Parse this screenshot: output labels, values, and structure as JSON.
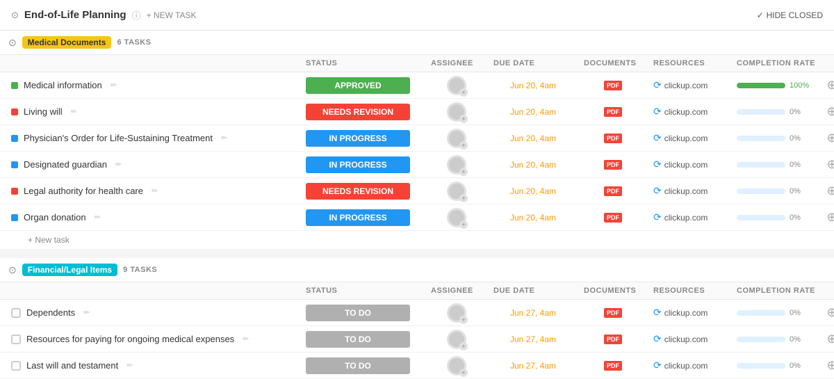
{
  "app": {
    "title": "End-of-Life Planning",
    "new_task_label": "+ NEW TASK",
    "hide_closed_label": "HIDE CLOSED"
  },
  "groups": [
    {
      "id": "medical",
      "collapse_icon": "⊙",
      "badge_label": "Medical Documents",
      "badge_class": "badge-yellow",
      "task_count": "6 TASKS",
      "columns": [
        "STATUS",
        "ASSIGNEE",
        "DUE DATE",
        "DOCUMENTS",
        "RESOURCES",
        "COMPLETION RATE"
      ],
      "tasks": [
        {
          "name": "Medical information",
          "dot_class": "dot-green",
          "status": "APPROVED",
          "status_class": "status-approved",
          "due_date": "Jun 20, 4am",
          "due_class": "due-date-normal",
          "resource": "clickup.com",
          "completion": 100,
          "completion_label": "100%",
          "pct_class": "full"
        },
        {
          "name": "Living will",
          "dot_class": "dot-red",
          "status": "NEEDS REVISION",
          "status_class": "status-needs-revision",
          "due_date": "Jun 20, 4am",
          "due_class": "",
          "resource": "clickup.com",
          "completion": 0,
          "completion_label": "0%",
          "pct_class": ""
        },
        {
          "name": "Physician's Order for Life-Sustaining Treatment",
          "dot_class": "dot-blue",
          "status": "IN PROGRESS",
          "status_class": "status-in-progress",
          "due_date": "Jun 20, 4am",
          "due_class": "",
          "resource": "clickup.com",
          "completion": 0,
          "completion_label": "0%",
          "pct_class": ""
        },
        {
          "name": "Designated guardian",
          "dot_class": "dot-blue",
          "status": "IN PROGRESS",
          "status_class": "status-in-progress",
          "due_date": "Jun 20, 4am",
          "due_class": "",
          "resource": "clickup.com",
          "completion": 0,
          "completion_label": "0%",
          "pct_class": ""
        },
        {
          "name": "Legal authority for health care",
          "dot_class": "dot-red",
          "status": "NEEDS REVISION",
          "status_class": "status-needs-revision",
          "due_date": "Jun 20, 4am",
          "due_class": "",
          "resource": "clickup.com",
          "completion": 0,
          "completion_label": "0%",
          "pct_class": ""
        },
        {
          "name": "Organ donation",
          "dot_class": "dot-blue",
          "status": "IN PROGRESS",
          "status_class": "status-in-progress",
          "due_date": "Jun 20, 4am",
          "due_class": "",
          "resource": "clickup.com",
          "completion": 0,
          "completion_label": "0%",
          "pct_class": ""
        }
      ],
      "new_task_label": "+ New task"
    },
    {
      "id": "financial",
      "collapse_icon": "⊙",
      "badge_label": "Financial/Legal Items",
      "badge_class": "badge-teal",
      "task_count": "9 TASKS",
      "columns": [
        "STATUS",
        "ASSIGNEE",
        "DUE DATE",
        "DOCUMENTS",
        "RESOURCES",
        "COMPLETION RATE"
      ],
      "tasks": [
        {
          "name": "Dependents",
          "dot_class": "dot-gray",
          "status": "TO DO",
          "status_class": "status-todo",
          "due_date": "Jun 27, 4am",
          "due_class": "",
          "resource": "clickup.com",
          "completion": 0,
          "completion_label": "0%",
          "pct_class": ""
        },
        {
          "name": "Resources for paying for ongoing medical expenses",
          "dot_class": "dot-gray",
          "status": "TO DO",
          "status_class": "status-todo",
          "due_date": "Jun 27, 4am",
          "due_class": "",
          "resource": "clickup.com",
          "completion": 0,
          "completion_label": "0%",
          "pct_class": ""
        },
        {
          "name": "Last will and testament",
          "dot_class": "dot-gray",
          "status": "TO DO",
          "status_class": "status-todo",
          "due_date": "Jun 27, 4am",
          "due_class": "",
          "resource": "clickup.com",
          "completion": 0,
          "completion_label": "0%",
          "pct_class": ""
        }
      ],
      "new_task_label": ""
    }
  ]
}
